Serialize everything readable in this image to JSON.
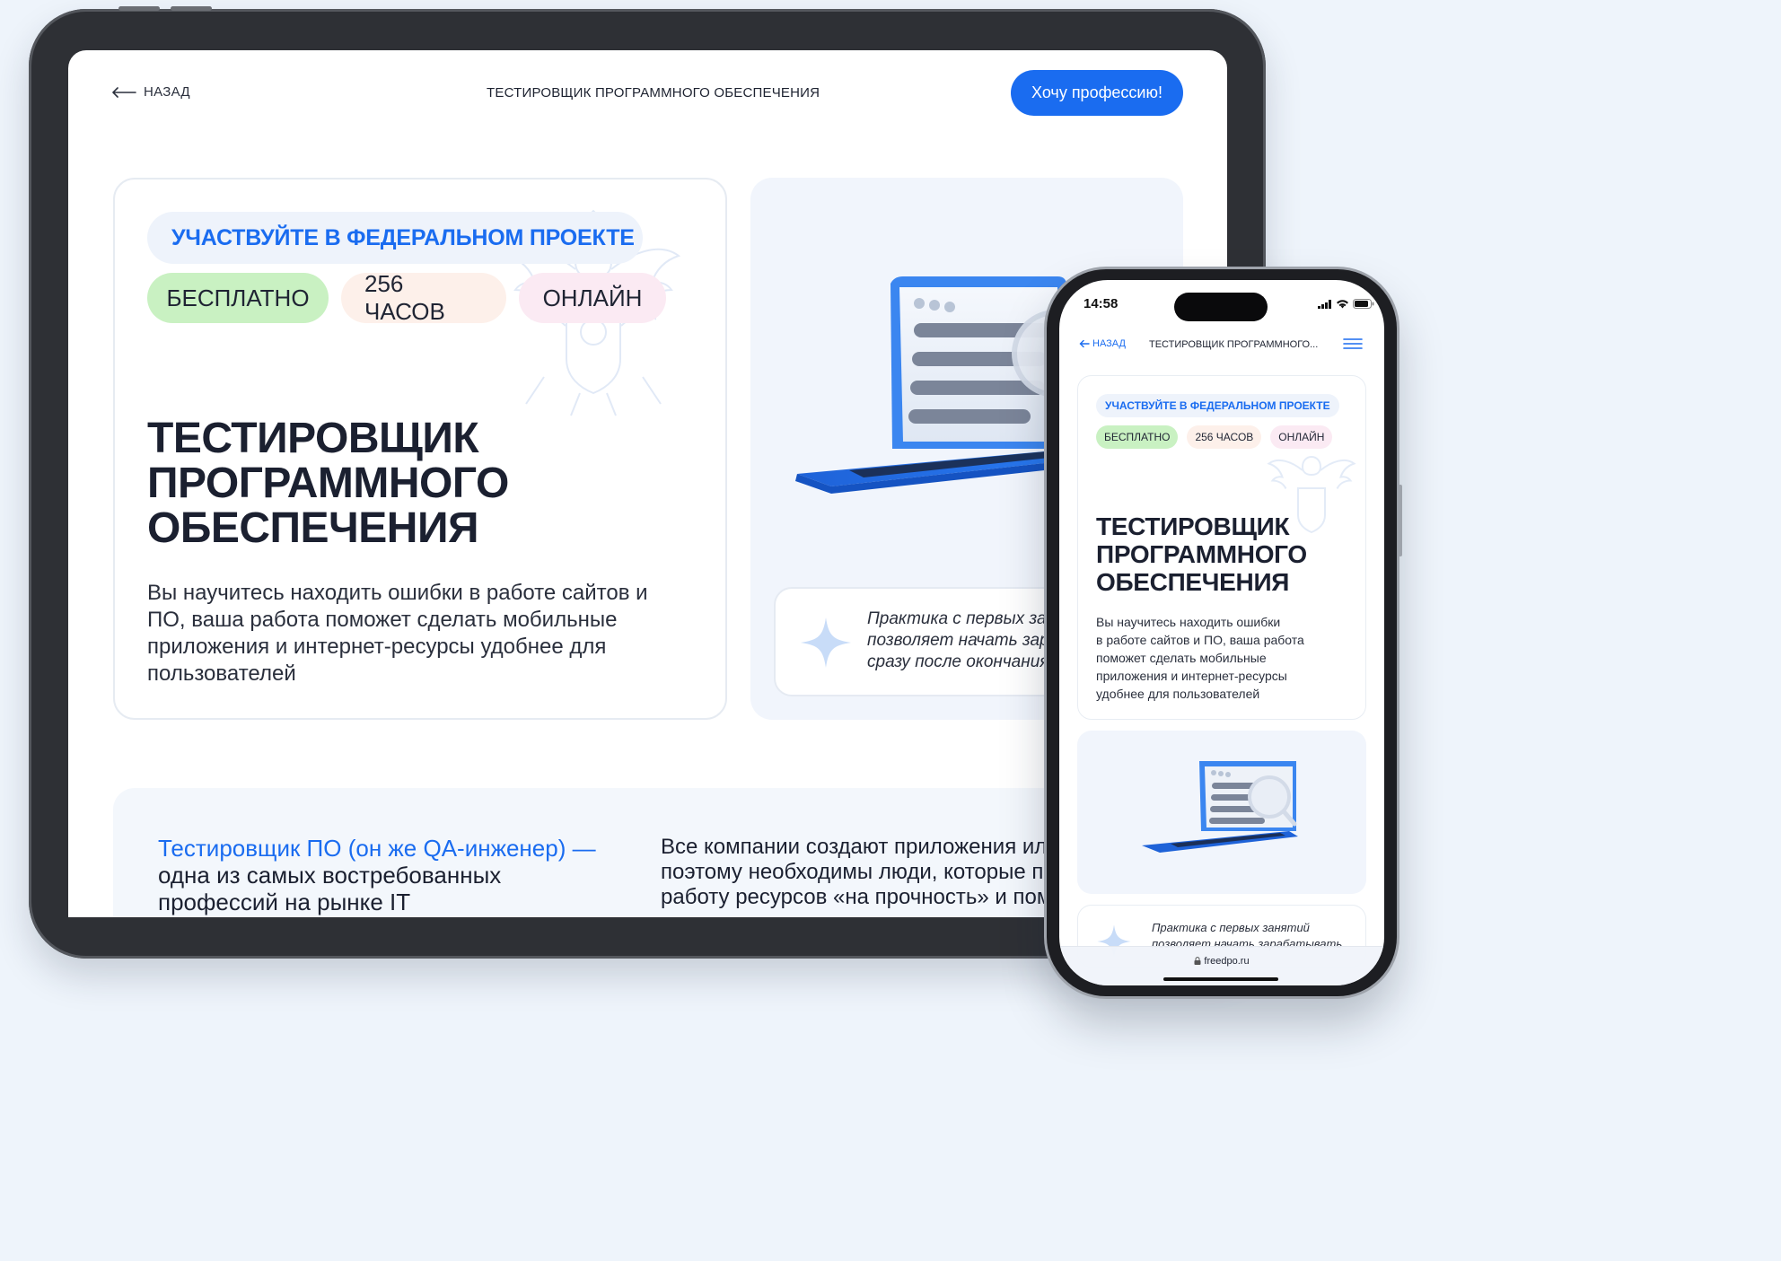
{
  "header": {
    "back_label": "НАЗАД",
    "title": "ТЕСТИРОВЩИК ПРОГРАММНОГО ОБЕСПЕЧЕНИЯ",
    "cta_label": "Хочу профессию!"
  },
  "hero": {
    "federal_label": "УЧАСТВУЙТЕ В ФЕДЕРАЛЬНОМ ПРОЕКТЕ",
    "tags": [
      "БЕСПЛАТНО",
      "256 ЧАСОВ",
      "ОНЛАЙН"
    ],
    "title_lines": [
      "ТЕСТИРОВЩИК",
      "ПРОГРАММНОГО",
      "ОБЕСПЕЧЕНИЯ"
    ],
    "description": "Вы научитесь находить ошибки в работе сайтов и ПО, ваша работа поможет сделать мобильные приложения и интернет-ресурсы удобнее для пользователей"
  },
  "practice": {
    "lines": [
      "Практика с первых зан",
      "позволяет начать зара",
      "сразу после окончания"
    ]
  },
  "about": {
    "accent": "Тестировщик ПО (он же QA-инженер) —",
    "text_lines": [
      "одна из самых востребованных",
      "профессий на рынке IT"
    ],
    "right_lines": [
      "Все компании создают приложения ил",
      "поэтому необходимы люди, которые п",
      "работу ресурсов «на прочность» и пом"
    ]
  },
  "phone": {
    "time": "14:58",
    "back_label": "НАЗАД",
    "title": "ТЕСТИРОВЩИК ПРОГРАММНОГО...",
    "federal_label": "УЧАСТВУЙТЕ В ФЕДЕРАЛЬНОМ ПРОЕКТЕ",
    "tags": [
      "БЕСПЛАТНО",
      "256 ЧАСОВ",
      "ОНЛАЙН"
    ],
    "title_lines": [
      "ТЕСТИРОВЩИК",
      "ПРОГРАММНОГО",
      "ОБЕСПЕЧЕНИЯ"
    ],
    "description_lines": [
      "Вы научитесь находить ошибки",
      "в работе сайтов и ПО, ваша работа",
      "поможет сделать мобильные",
      "приложения и интернет-ресурсы",
      "удобнее для пользователей"
    ],
    "practice_lines": [
      "Практика с первых занятий",
      "позволяет начать зарабатывать"
    ],
    "url": "freedpo.ru"
  },
  "colors": {
    "accent": "#1a6cf0",
    "tag_free": "#c9f1c2",
    "tag_hours": "#fdf0ea",
    "tag_online": "#fbeaf3",
    "illus_bg": "#f1f5fc"
  },
  "icons": [
    "arrow-left-icon",
    "hamburger-menu-icon",
    "sparkle-icon",
    "laptop-illustration",
    "magnifier-icon",
    "emblem-watermark",
    "signal-icon",
    "wifi-icon",
    "battery-icon",
    "lock-icon"
  ]
}
